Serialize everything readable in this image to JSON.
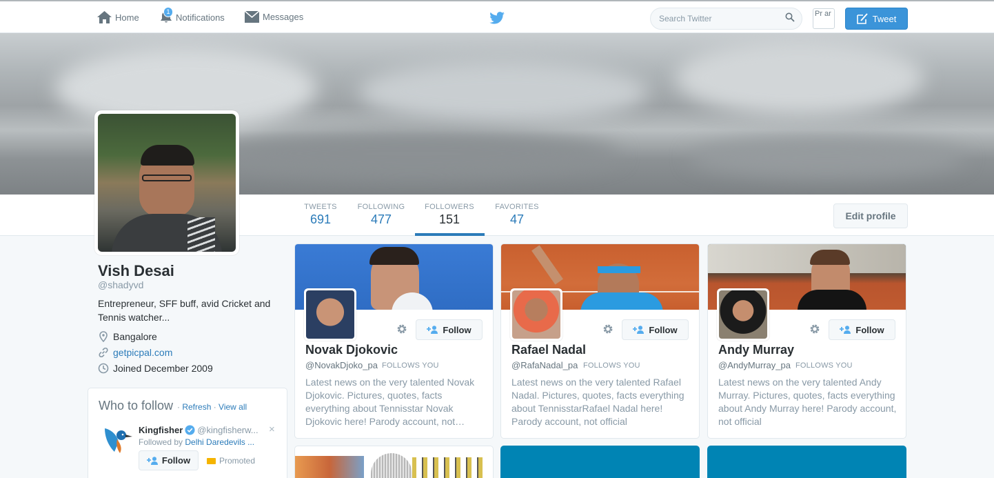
{
  "topnav": {
    "home_label": "Home",
    "notifications_label": "Notifications",
    "notifications_count": "1",
    "messages_label": "Messages",
    "search_placeholder": "Search Twitter",
    "avatar_alt": "Pr ar",
    "tweet_label": "Tweet"
  },
  "profile": {
    "name": "Vish Desai",
    "handle": "@shadyvd",
    "bio": "Entrepreneur, SFF buff, avid Cricket and Tennis watcher...",
    "location": "Bangalore",
    "website": "getpicpal.com",
    "joined": "Joined December 2009"
  },
  "stats": [
    {
      "label": "TWEETS",
      "value": "691"
    },
    {
      "label": "FOLLOWING",
      "value": "477"
    },
    {
      "label": "FOLLOWERS",
      "value": "151"
    },
    {
      "label": "FAVORITES",
      "value": "47"
    }
  ],
  "edit_profile_label": "Edit profile",
  "who_to_follow": {
    "title": "Who to follow",
    "sep1": " · ",
    "refresh": "Refresh",
    "sep2": " · ",
    "view_all": "View all",
    "suggestion": {
      "name": "Kingfisher",
      "handle": "@kingfisherw...",
      "followed_by_prefix": "Followed by ",
      "followed_by_name": "Delhi Daredevils ...",
      "follow_label": "Follow",
      "promoted_label": "Promoted",
      "close": "×"
    }
  },
  "cards": [
    {
      "name": "Novak Djokovic",
      "handle": "@NovakDjoko_pa",
      "follows_you": "FOLLOWS YOU",
      "bio": "Latest news on the very talented Novak Djokovic. Pictures, quotes, facts everything about Tennisstar Novak Djokovic here! Parody account, not…",
      "follow_label": "Follow"
    },
    {
      "name": "Rafael Nadal",
      "handle": "@RafaNadal_pa",
      "follows_you": "FOLLOWS YOU",
      "bio": "Latest news on the very talented Rafael Nadal. Pictures, quotes, facts everything about TennisstarRafael Nadal here! Parody account, not official",
      "follow_label": "Follow"
    },
    {
      "name": "Andy Murray",
      "handle": "@AndyMurray_pa",
      "follows_you": "FOLLOWS YOU",
      "bio": "Latest news on the very talented Andy Murray. Pictures, quotes, facts everything about Andy Murray here! Parody account, not official",
      "follow_label": "Follow"
    }
  ],
  "colors": {
    "link": "#2b7bb9",
    "tweet_button": "#3b94d9",
    "card_teal": "#0084b4"
  }
}
